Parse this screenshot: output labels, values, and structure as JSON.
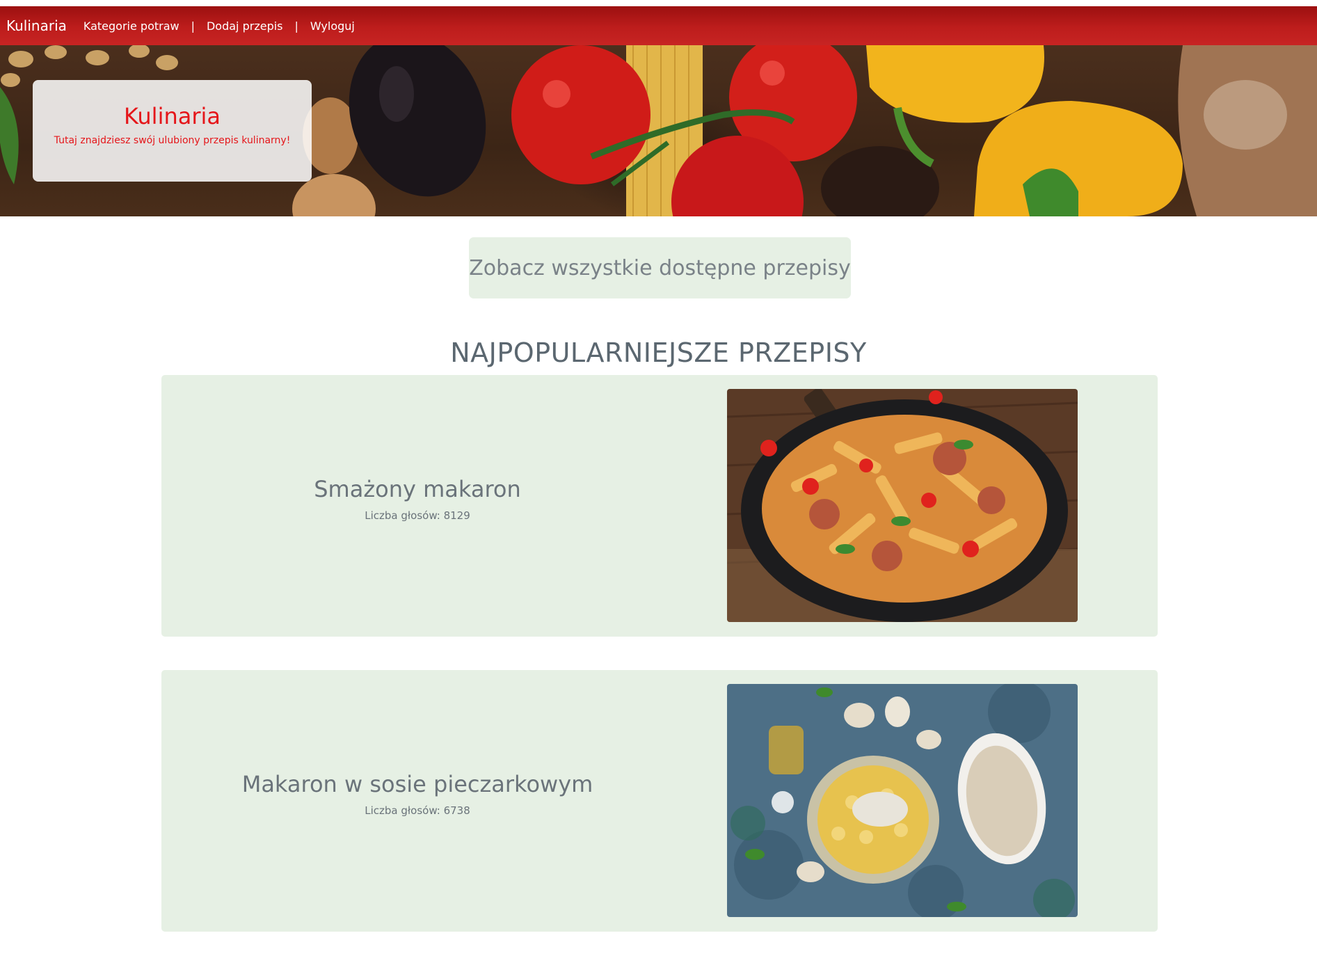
{
  "navbar": {
    "brand": "Kulinaria",
    "links": [
      "Kategorie potraw",
      "Dodaj przepis",
      "Wyloguj"
    ],
    "separator": "|"
  },
  "hero": {
    "title": "Kulinaria",
    "subtitle": "Tutaj znajdziesz swój ulubiony przepis kulinarny!"
  },
  "cta": {
    "label": "Zobacz wszystkie dostępne przepisy"
  },
  "popular": {
    "heading": "NAJPOPULARNIEJSZE PRZEPISY",
    "recipes": [
      {
        "title": "Smażony makaron",
        "votes": "Liczba głosów: 8129"
      },
      {
        "title": "Makaron w sosie pieczarkowym",
        "votes": "Liczba głosów: 6738"
      }
    ]
  },
  "colors": {
    "navbar": "#bd1d1c",
    "accent_red": "#e5161a",
    "card_bg": "#e6f0e4",
    "text_gray": "#5b6770"
  }
}
